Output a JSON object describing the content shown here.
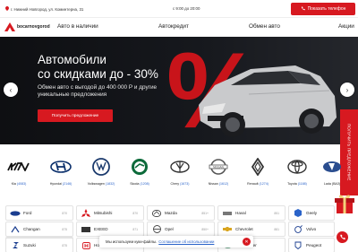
{
  "topbar": {
    "address": "г. Нижний Новгород, ул. Коминтерна, 31",
    "phone": "с 9:00 до 20:00",
    "call_button": "Показать телефон"
  },
  "logo": {
    "text": "bocarnovgorod"
  },
  "nav": [
    {
      "label": "Авто в наличии"
    },
    {
      "label": "Автокредит"
    },
    {
      "label": "Обмен авто"
    },
    {
      "label": "Акции"
    }
  ],
  "hero": {
    "title_line1": "Автомобили",
    "title_line2": "со скидками до - 30%",
    "subtitle": "Обмен авто с выгодой до 400 000 Р и другие уникальные предложения",
    "button": "Получить предложение",
    "percent_sign": "%"
  },
  "side_tab": "ПОЛУЧИТЬ ПРЕДЛОЖЕНИЕ",
  "brands": [
    {
      "name": "Kia",
      "count": "(4083)"
    },
    {
      "name": "Hyundai",
      "count": "(2146)"
    },
    {
      "name": "Volkswagen",
      "count": "(1832)"
    },
    {
      "name": "Skoda",
      "count": "(1208)"
    },
    {
      "name": "Chery",
      "count": "(1673)"
    },
    {
      "name": "Nissan",
      "count": "(1612)"
    },
    {
      "name": "Renault",
      "count": "(1274)"
    },
    {
      "name": "Toyota",
      "count": "(1188)"
    },
    {
      "name": "Lada (ВАЗ)",
      "count": ""
    }
  ],
  "models": [
    {
      "name": "Ford",
      "num": "870"
    },
    {
      "name": "Mitsubishi",
      "num": "870"
    },
    {
      "name": "Mazda",
      "num": "851+"
    },
    {
      "name": "Haval",
      "num": "851"
    },
    {
      "name": "Geely",
      "num": ""
    },
    {
      "name": "Changan",
      "num": "875"
    },
    {
      "name": "EXEED",
      "num": "871"
    },
    {
      "name": "Opel",
      "num": "850+"
    },
    {
      "name": "Chevrolet",
      "num": "881"
    },
    {
      "name": "Volvo",
      "num": ""
    },
    {
      "name": "Suzuki",
      "num": "875"
    },
    {
      "name": "Honda",
      "num": ""
    },
    {
      "name": "",
      "num": ""
    },
    {
      "name": "Land Rover",
      "num": ""
    },
    {
      "name": "Peugeot",
      "num": ""
    }
  ],
  "cookie": {
    "text": "Мы используем куки-файлы.",
    "link": "Соглашение об использовании",
    "close": "✕"
  },
  "colors": {
    "accent": "#d71920",
    "link": "#2a63c9"
  }
}
